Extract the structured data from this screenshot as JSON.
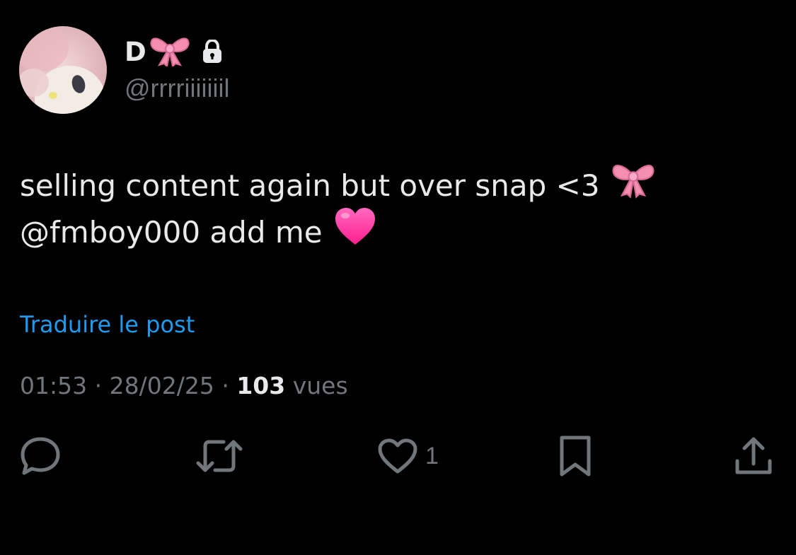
{
  "author": {
    "display_name": "D",
    "display_name_emoji": "ribbon-emoji",
    "locked": true,
    "handle": "@rrrriiiiiiil"
  },
  "tweet": {
    "line1": "selling content again but over snap <3",
    "line2": "@fmboy000 add me",
    "line1_emoji": "ribbon-emoji",
    "line2_emoji": "pink-heart-emoji"
  },
  "translate_label": "Traduire le post",
  "meta": {
    "time": "01:53",
    "separator": "·",
    "date": "28/02/25",
    "views_count": "103",
    "views_label": "vues"
  },
  "actions": {
    "reply_icon": "reply-icon",
    "retweet_icon": "retweet-icon",
    "like_icon": "heart-outline-icon",
    "like_count": "1",
    "bookmark_icon": "bookmark-icon",
    "share_icon": "share-icon"
  },
  "colors": {
    "background": "#000000",
    "primary_text": "#e7e9ea",
    "secondary_text": "#71767b",
    "link": "#1d9bf0",
    "ribbon_pink": "#f48fb1",
    "heart_pink": "#ff3d9a"
  }
}
